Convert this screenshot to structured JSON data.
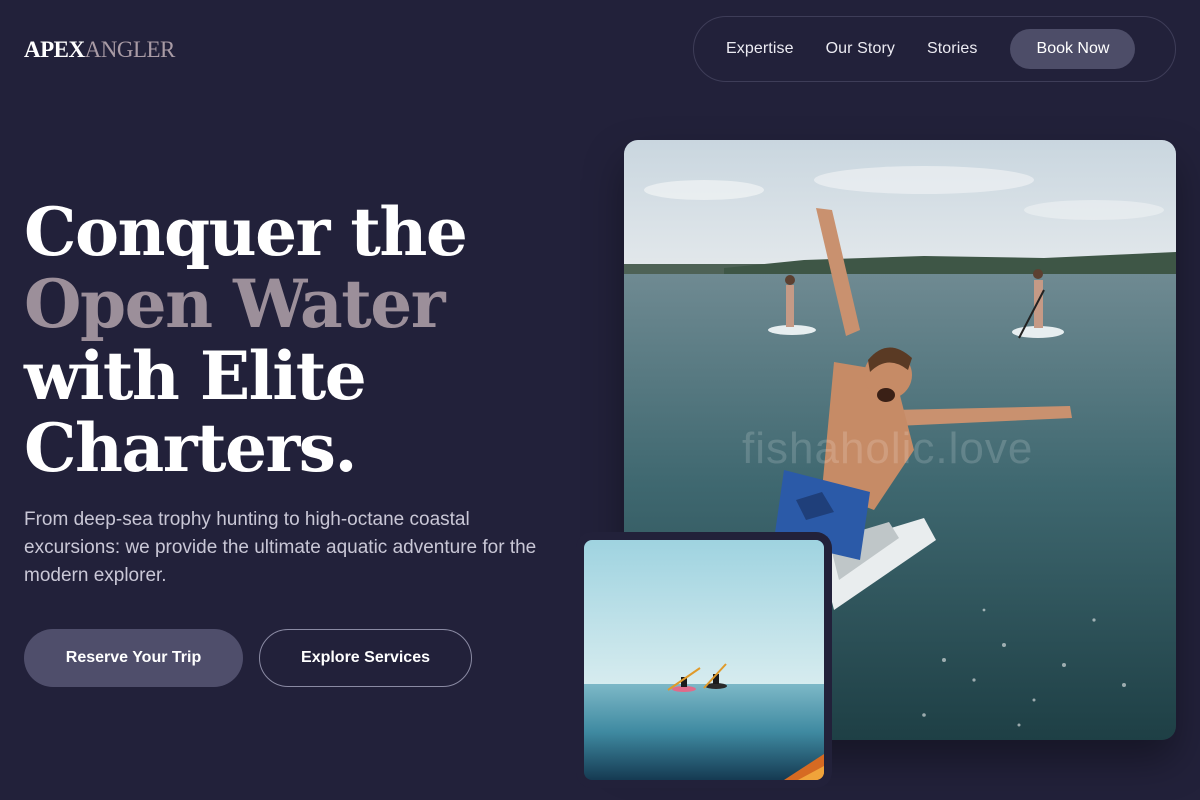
{
  "brand": {
    "part1": "APEX",
    "part2": "ANGLER"
  },
  "nav": {
    "links": [
      "Expertise",
      "Our Story",
      "Stories"
    ],
    "cta": "Book Now"
  },
  "hero": {
    "line1": "Conquer the",
    "accent": "Open Water",
    "line3": "with Elite",
    "line4": "Charters.",
    "subtitle": "From deep-sea trophy hunting to high-octane coastal excursions: we provide the ultimate aquatic adventure for the modern explorer.",
    "primary_cta": "Reserve Your Trip",
    "secondary_cta": "Explore Services"
  },
  "media": {
    "watermark": "fishaholic.love"
  },
  "colors": {
    "background": "#22213a",
    "accent_text": "#9c8f9a",
    "button_fill": "#4f4e6b"
  }
}
